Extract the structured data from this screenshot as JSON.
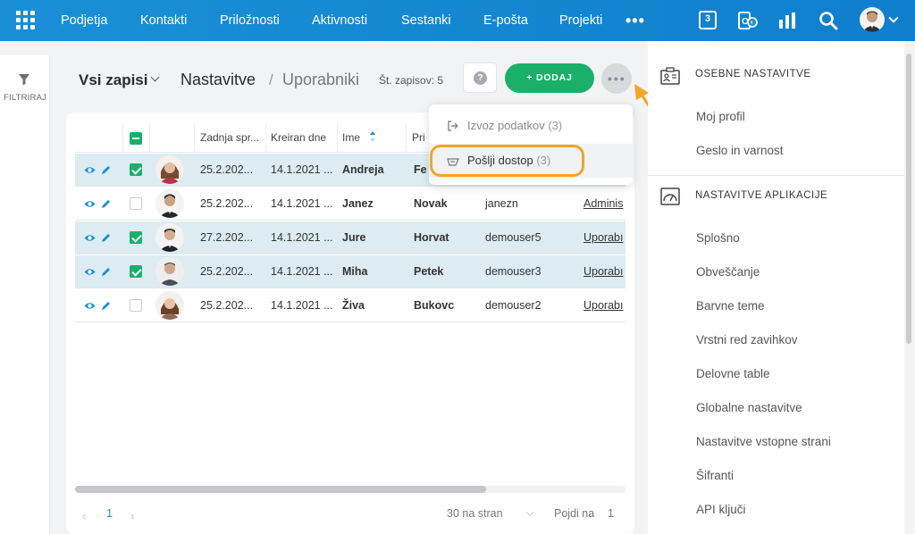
{
  "topbar": {
    "nav": [
      "Podjetja",
      "Kontakti",
      "Priložnosti",
      "Aktivnosti",
      "Sestanki",
      "E-pošta",
      "Projekti"
    ],
    "more_label": "•••",
    "calendar_day": "3",
    "colors": {
      "bar": "#1a8fd6",
      "accent_green": "#1ab06a",
      "highlight_orange": "#f2a526"
    }
  },
  "sidebar_left": {
    "filter_label": "FILTRIRAJ"
  },
  "header": {
    "view_label": "Vsi zapisi",
    "breadcrumb_root": "Nastavitve",
    "breadcrumb_sep": "/",
    "breadcrumb_current": "Uporabniki",
    "record_count": "Št. zapisov: 5",
    "help_label": "?",
    "add_label": "+ DODAJ"
  },
  "table": {
    "columns": [
      "Zadnja spr...",
      "Kreiran dne",
      "Ime",
      "Pri"
    ],
    "rows": [
      {
        "selected": true,
        "changed": "25.2.202...",
        "created": "14.1.2021 ...",
        "first": "Andreja",
        "last": "Fe",
        "user": "",
        "role": ""
      },
      {
        "selected": false,
        "changed": "25.2.202...",
        "created": "14.1.2021 ...",
        "first": "Janez",
        "last": "Novak",
        "user": "janezn",
        "role": "Adminis"
      },
      {
        "selected": true,
        "changed": "27.2.202...",
        "created": "14.1.2021 ...",
        "first": "Jure",
        "last": "Horvat",
        "user": "demouser5",
        "role": "Uporabı"
      },
      {
        "selected": true,
        "changed": "25.2.202...",
        "created": "14.1.2021 ...",
        "first": "Miha",
        "last": "Petek",
        "user": "demouser3",
        "role": "Uporabı"
      },
      {
        "selected": false,
        "changed": "25.2.202...",
        "created": "14.1.2021 ...",
        "first": "Živa",
        "last": "Bukovc",
        "user": "demouser2",
        "role": "Uporabı"
      }
    ],
    "pagination": {
      "prev": "‹",
      "page": "1",
      "next": "›",
      "per_page": "30 na stran",
      "goto_label": "Pojdi na",
      "goto_value": "1"
    }
  },
  "dropdown": {
    "items": [
      {
        "label": "Izvoz podatkov",
        "count": "(3)",
        "icon": "export-icon"
      },
      {
        "label": "Pošlji dostop",
        "count": "(3)",
        "icon": "send-icon"
      }
    ]
  },
  "right_panel": {
    "sections": [
      {
        "title": "OSEBNE NASTAVITVE",
        "icon": "id-card-icon",
        "items": [
          "Moj profil",
          "Geslo in varnost"
        ]
      },
      {
        "title": "NASTAVITVE APLIKACIJE",
        "icon": "gauge-icon",
        "items": [
          "Splošno",
          "Obveščanje",
          "Barvne teme",
          "Vrstni red zavihkov",
          "Delovne table",
          "Globalne nastavitve",
          "Nastavitve vstopne strani",
          "Šifranti",
          "API ključi"
        ]
      }
    ]
  }
}
